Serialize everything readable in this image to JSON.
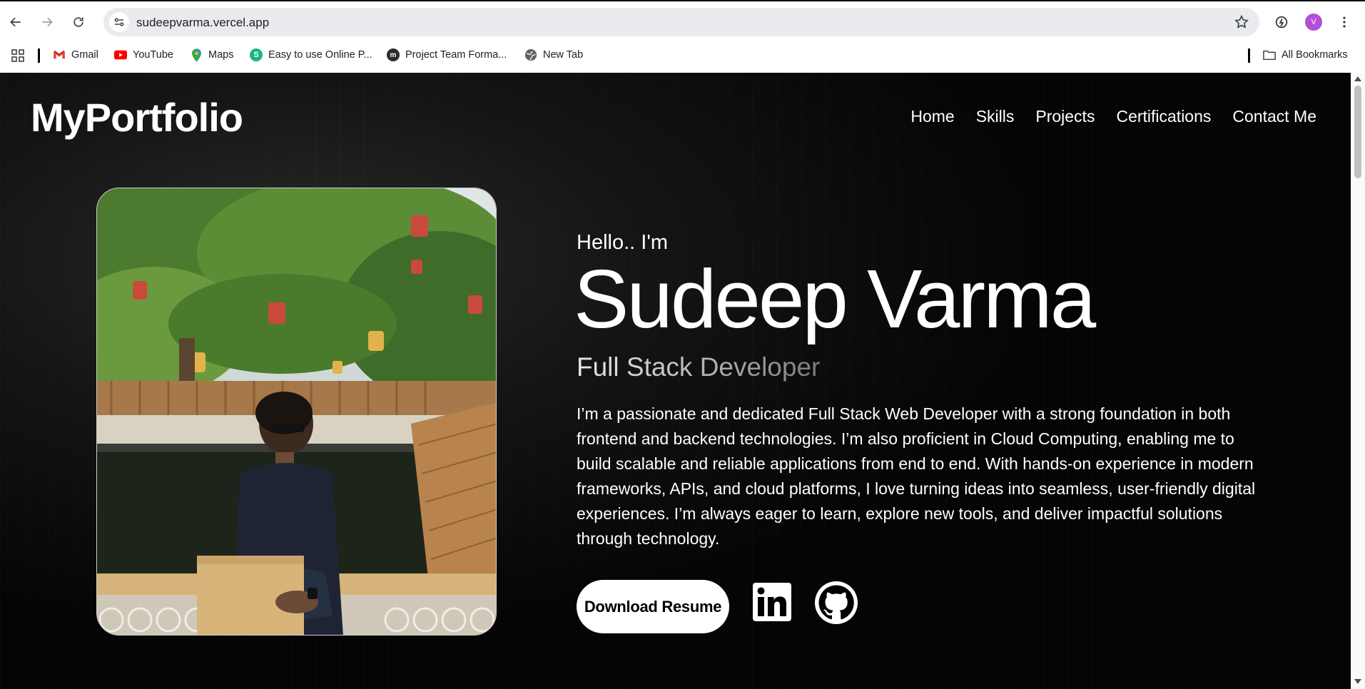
{
  "browser": {
    "url": "sudeepvarma.vercel.app",
    "profile_initial": "V",
    "bookmarks": [
      {
        "label": "Gmail",
        "icon": "gmail-icon"
      },
      {
        "label": "YouTube",
        "icon": "youtube-icon"
      },
      {
        "label": "Maps",
        "icon": "maps-icon"
      },
      {
        "label": "Easy to use Online P...",
        "icon": "s-green-icon"
      },
      {
        "label": "Project Team Forma...",
        "icon": "m-logo-icon"
      },
      {
        "label": "New Tab",
        "icon": "globe-icon"
      }
    ],
    "all_bookmarks_label": "All Bookmarks"
  },
  "site": {
    "logo": "MyPortfolio",
    "nav": [
      "Home",
      "Skills",
      "Projects",
      "Certifications",
      "Contact Me"
    ],
    "hero": {
      "greeting": "Hello.. I'm",
      "name": "Sudeep Varma",
      "role": "Full Stack Developer",
      "bio": "I’m a passionate and dedicated Full Stack Web Developer with a strong foundation in both frontend and backend technologies. I’m also proficient in Cloud Computing, enabling me to build scalable and reliable applications from end to end. With hands-on experience in modern frameworks, APIs, and cloud platforms, I love turning ideas into seamless, user-friendly digital experiences. I’m always eager to learn, explore new tools, and deliver impactful solutions through technology.",
      "resume_button": "Download Resume"
    }
  },
  "colors": {
    "page_bg": "#0a0a0a",
    "text": "#ffffff",
    "avatar": "#b24fd6"
  }
}
